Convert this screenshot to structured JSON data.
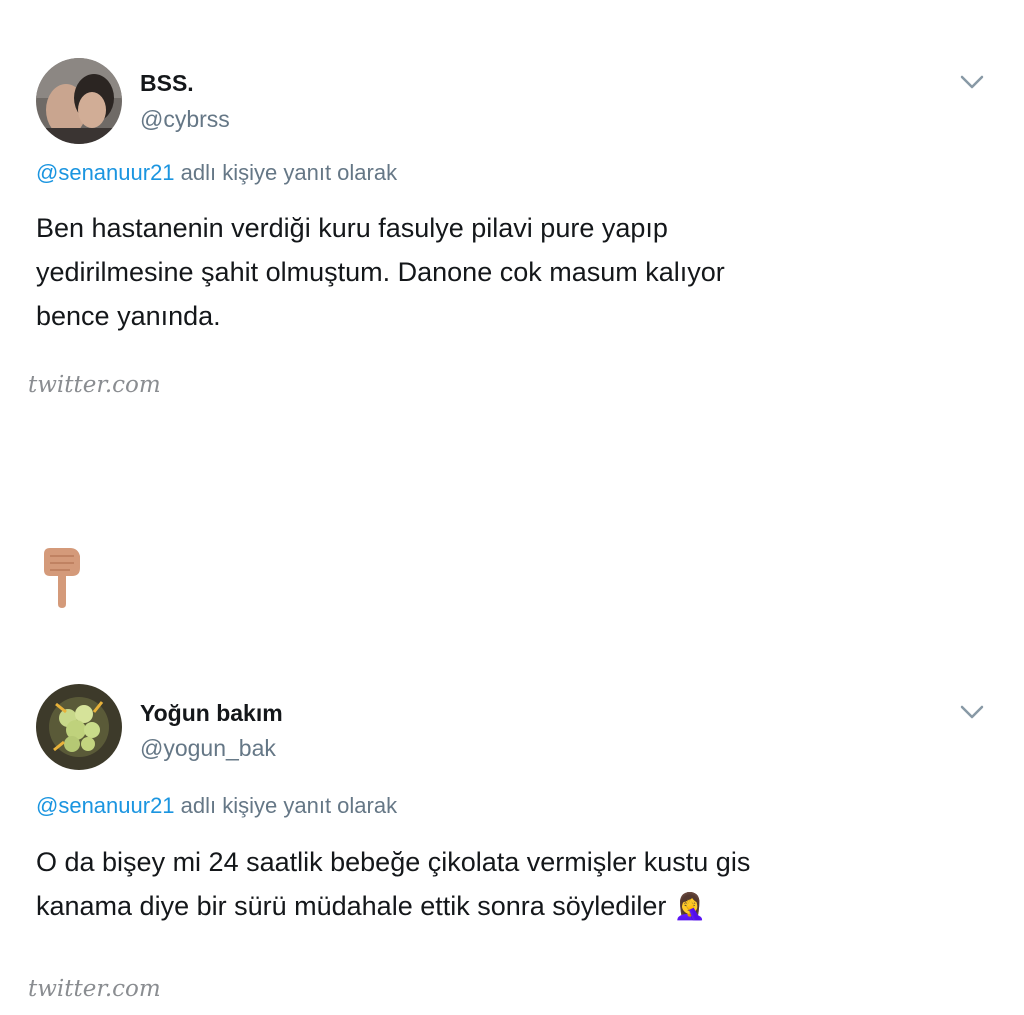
{
  "tweets": [
    {
      "display_name": "BSS.",
      "handle": "@cybrss",
      "reply_mention": "@senanuur21",
      "reply_suffix": "adlı kişiye yanıt olarak",
      "text_lines": [
        "Ben hastanenin verdiği kuru fasulye pilavi pure yapıp",
        "yedirilmesine şahit olmuştum. Danone cok masum kalıyor",
        "bence yanında."
      ],
      "source": "twitter.com",
      "menu_icon": "chevron-down-icon"
    },
    {
      "display_name": "Yoğun bakım",
      "handle": "@yogun_bak",
      "reply_mention": "@senanuur21",
      "reply_suffix": "adlı kişiye yanıt olarak",
      "text_lines": [
        "O da bişey mi 24 saatlik bebeğe çikolata vermişler kustu gis",
        "kanama diye bir sürü müdahale ettik sonra söylediler"
      ],
      "emoji": "🤦‍♀️",
      "source": "twitter.com",
      "menu_icon": "chevron-down-icon"
    }
  ],
  "separator_icon": "pointing-down-hand-icon",
  "colors": {
    "mention": "#1b95e0",
    "secondary_text": "#657786",
    "primary_text": "#14171a"
  }
}
